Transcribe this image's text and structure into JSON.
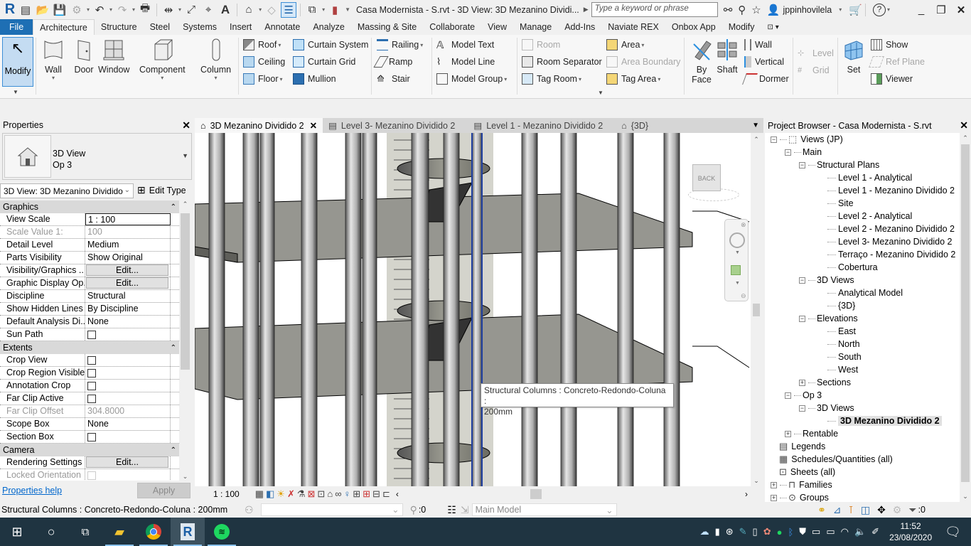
{
  "titlebar": {
    "app_logo": "R",
    "document_title": "Casa Modernista - S.rvt - 3D View: 3D Mezanino Dividi...",
    "search_placeholder": "Type a keyword or phrase",
    "username": "jppinhovilela",
    "icons": [
      "app-menu-icon",
      "open-icon",
      "save-icon",
      "sync-icon",
      "undo-icon",
      "redo-icon",
      "print-icon",
      "measure-icon",
      "dimension-icon",
      "tag-icon",
      "text-icon",
      "3d-view-icon",
      "section-icon",
      "thin-lines-icon",
      "switch-windows-icon",
      "customize-icon"
    ]
  },
  "ribbon_tabs": [
    {
      "label": "File",
      "state": "file"
    },
    {
      "label": "Architecture",
      "state": "active"
    },
    {
      "label": "Structure"
    },
    {
      "label": "Steel"
    },
    {
      "label": "Systems"
    },
    {
      "label": "Insert"
    },
    {
      "label": "Annotate"
    },
    {
      "label": "Analyze"
    },
    {
      "label": "Massing & Site"
    },
    {
      "label": "Collaborate"
    },
    {
      "label": "View"
    },
    {
      "label": "Manage"
    },
    {
      "label": "Add-Ins"
    },
    {
      "label": "Naviate REX"
    },
    {
      "label": "Onbox App"
    },
    {
      "label": "Modify"
    }
  ],
  "ribbon": {
    "modify": "Modify",
    "wall": "Wall",
    "door": "Door",
    "window": "Window",
    "component": "Component",
    "column": "Column",
    "roof": "Roof",
    "ceiling": "Ceiling",
    "floor": "Floor",
    "curtain_system": "Curtain  System",
    "curtain_grid": "Curtain  Grid",
    "mullion": "Mullion",
    "railing": "Railing",
    "ramp": "Ramp",
    "stair": "Stair",
    "model_text": "Model  Text",
    "model_line": "Model  Line",
    "model_group": "Model  Group",
    "room": "Room",
    "room_separator": "Room  Separator",
    "tag_room": "Tag  Room",
    "area": "Area",
    "area_boundary": "Area  Boundary",
    "tag_area": "Tag  Area",
    "by_face": "By\nFace",
    "by_face_1": "By",
    "by_face_2": "Face",
    "shaft": "Shaft",
    "wall_opening": "Wall",
    "vertical": "Vertical",
    "dormer": "Dormer",
    "level": "Level",
    "grid": "Grid",
    "set": "Set",
    "show": "Show",
    "ref_plane": "Ref  Plane",
    "viewer": "Viewer"
  },
  "properties": {
    "title": "Properties",
    "type_line1": "3D View",
    "type_line2": "Op 3",
    "instance_selector": "3D View: 3D Mezanino Dividido",
    "edit_type": "Edit Type",
    "groups": [
      {
        "name": "Graphics",
        "rows": [
          {
            "name": "View Scale",
            "value": "1 : 100",
            "kind": "input"
          },
          {
            "name": "Scale Value    1:",
            "value": "100",
            "kind": "text",
            "dim": true
          },
          {
            "name": "Detail Level",
            "value": "Medium",
            "kind": "text"
          },
          {
            "name": "Parts Visibility",
            "value": "Show Original",
            "kind": "text"
          },
          {
            "name": "Visibility/Graphics ...",
            "value": "Edit...",
            "kind": "button"
          },
          {
            "name": "Graphic Display Op...",
            "value": "Edit...",
            "kind": "button"
          },
          {
            "name": "Discipline",
            "value": "Structural",
            "kind": "text"
          },
          {
            "name": "Show Hidden Lines",
            "value": "By Discipline",
            "kind": "text"
          },
          {
            "name": "Default Analysis Di...",
            "value": "None",
            "kind": "text"
          },
          {
            "name": "Sun Path",
            "value": "",
            "kind": "checkbox",
            "checked": false
          }
        ]
      },
      {
        "name": "Extents",
        "rows": [
          {
            "name": "Crop View",
            "value": "",
            "kind": "checkbox",
            "checked": false
          },
          {
            "name": "Crop Region Visible",
            "value": "",
            "kind": "checkbox",
            "checked": false
          },
          {
            "name": "Annotation Crop",
            "value": "",
            "kind": "checkbox",
            "checked": false
          },
          {
            "name": "Far Clip Active",
            "value": "",
            "kind": "checkbox",
            "checked": false
          },
          {
            "name": "Far Clip Offset",
            "value": "304.8000",
            "kind": "text",
            "dim": true
          },
          {
            "name": "Scope Box",
            "value": "None",
            "kind": "text"
          },
          {
            "name": "Section Box",
            "value": "",
            "kind": "checkbox",
            "checked": false
          }
        ]
      },
      {
        "name": "Camera",
        "rows": [
          {
            "name": "Rendering Settings",
            "value": "Edit...",
            "kind": "button"
          },
          {
            "name": "Locked Orientation",
            "value": "",
            "kind": "checkbox",
            "checked": false,
            "dim": true
          }
        ]
      }
    ],
    "help_link": "Properties help",
    "apply": "Apply"
  },
  "view_tabs": [
    {
      "label": "3D Mezanino Dividido 2",
      "icon": "3d-view-icon",
      "active": true
    },
    {
      "label": "Level 3- Mezanino Dividido 2",
      "icon": "plan-view-icon"
    },
    {
      "label": "Level 1 - Mezanino Dividido 2",
      "icon": "plan-view-icon"
    },
    {
      "label": "{3D}",
      "icon": "3d-view-icon"
    }
  ],
  "viewport": {
    "tooltip_line1": "Structural Columns : Concreto-Redondo-Coluna :",
    "tooltip_line2": "200mm",
    "viewcube_face": "BACK"
  },
  "view_control_bar": {
    "scale": "1 : 100"
  },
  "project_browser": {
    "title": "Project Browser - Casa Modernista - S.rvt",
    "nodes": [
      {
        "label": "Views (JP)",
        "level": 0,
        "toggle": "-",
        "icon": "views-icon"
      },
      {
        "label": "Main",
        "level": 1,
        "toggle": "-"
      },
      {
        "label": "Structural Plans",
        "level": 2,
        "toggle": "-"
      },
      {
        "label": "Level 1 - Analytical",
        "level": 3
      },
      {
        "label": "Level 1 - Mezanino Dividido 2",
        "level": 3
      },
      {
        "label": "Site",
        "level": 3
      },
      {
        "label": "Level 2 - Analytical",
        "level": 3
      },
      {
        "label": "Level 2 - Mezanino Dividido 2",
        "level": 3
      },
      {
        "label": "Level 3- Mezanino Dividido 2",
        "level": 3
      },
      {
        "label": "Terraço - Mezanino Dividido 2",
        "level": 3
      },
      {
        "label": "Cobertura",
        "level": 3
      },
      {
        "label": "3D Views",
        "level": 2,
        "toggle": "-"
      },
      {
        "label": "Analytical Model",
        "level": 3
      },
      {
        "label": "{3D}",
        "level": 3
      },
      {
        "label": "Elevations",
        "level": 2,
        "toggle": "-"
      },
      {
        "label": "East",
        "level": 3
      },
      {
        "label": "North",
        "level": 3
      },
      {
        "label": "South",
        "level": 3
      },
      {
        "label": "West",
        "level": 3
      },
      {
        "label": "Sections",
        "level": 2,
        "toggle": "+"
      },
      {
        "label": "Op 3",
        "level": 1,
        "toggle": "-"
      },
      {
        "label": "3D Views",
        "level": 2,
        "toggle": "-"
      },
      {
        "label": "3D Mezanino Dividido 2",
        "level": 3,
        "selected": true
      },
      {
        "label": "Rentable",
        "level": 1,
        "toggle": "+"
      },
      {
        "label": "Legends",
        "level": 0,
        "icon": "legends-icon"
      },
      {
        "label": "Schedules/Quantities (all)",
        "level": 0,
        "icon": "schedules-icon"
      },
      {
        "label": "Sheets (all)",
        "level": 0,
        "icon": "sheets-icon"
      },
      {
        "label": "Families",
        "level": 0,
        "toggle": "+",
        "icon": "families-icon"
      },
      {
        "label": "Groups",
        "level": 0,
        "toggle": "+",
        "icon": "groups-icon"
      }
    ]
  },
  "statusbar": {
    "message": "Structural Columns : Concreto-Redondo-Coluna : 200mm",
    "design_option_count": ":0",
    "workset": "Main Model",
    "filter_count": ":0"
  },
  "taskbar": {
    "time": "11:52",
    "date": "23/08/2020",
    "apps": [
      "start",
      "search",
      "task-view",
      "file-explorer",
      "chrome",
      "revit",
      "spotify"
    ]
  },
  "colors": {
    "file_tab": "#1e6fb4",
    "modify_active": "#c4dcf2",
    "selection_blue": "#1f3fa0",
    "taskbar": "#1f3441"
  }
}
